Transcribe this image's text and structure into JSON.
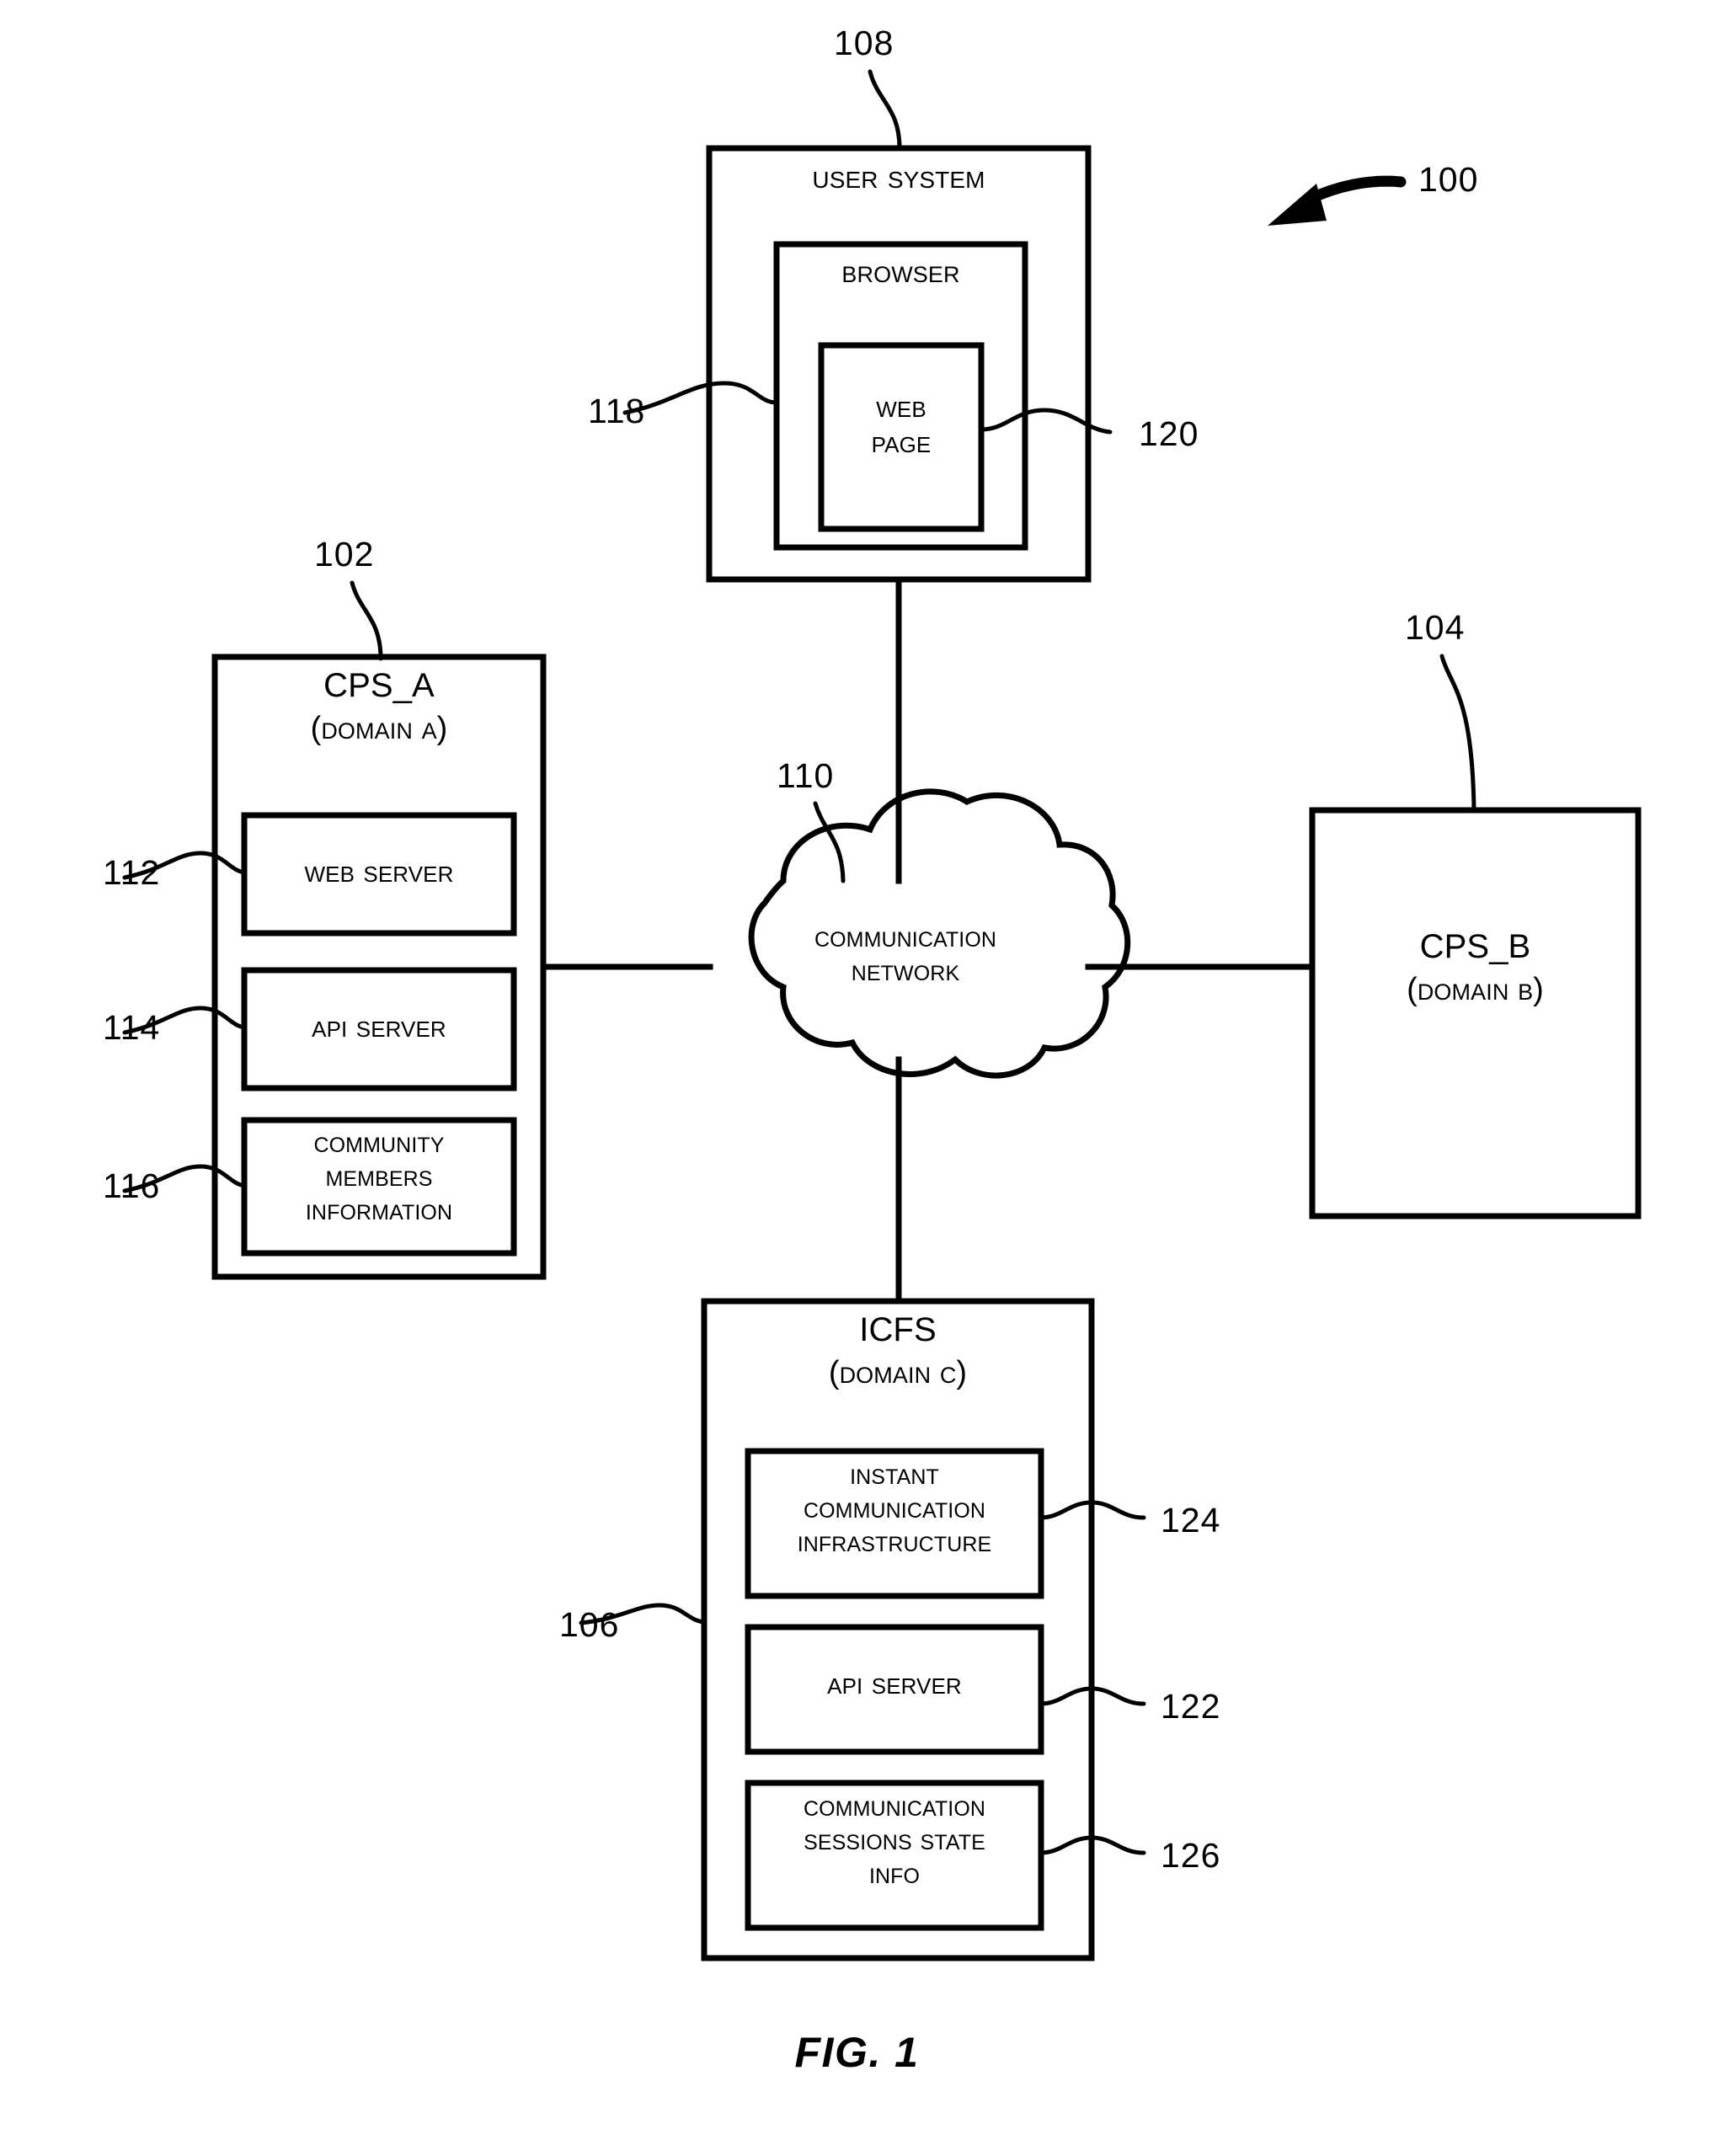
{
  "figure": {
    "caption": "FIG. 1",
    "system_ref": "100"
  },
  "nodes": {
    "user_system": {
      "title": "User System",
      "ref": "108",
      "browser": {
        "title": "Browser",
        "ref": "118",
        "web_page": {
          "title": "Web\nPage",
          "ref": "120"
        }
      }
    },
    "cps_a": {
      "title": "CPS_A",
      "subtitle": "(Domain A)",
      "ref": "102",
      "components": [
        {
          "label": "Web Server",
          "ref": "112"
        },
        {
          "label": "API Server",
          "ref": "114"
        },
        {
          "label": "Community\nMembers\nInformation",
          "ref": "116"
        }
      ]
    },
    "cps_b": {
      "title": "CPS_B",
      "subtitle": "(Domain B)",
      "ref": "104"
    },
    "network": {
      "title": "Communication\nNetwork",
      "ref": "110"
    },
    "icfs": {
      "title": "ICFS",
      "subtitle": "(Domain C)",
      "ref": "106",
      "components": [
        {
          "label": "Instant\nCommunication\nInfrastructure",
          "ref": "124"
        },
        {
          "label": "API Server",
          "ref": "122"
        },
        {
          "label": "Communication\nSessions State\nInfo",
          "ref": "126"
        }
      ]
    }
  },
  "style": {
    "line_color": "#000000",
    "background": "#ffffff"
  }
}
